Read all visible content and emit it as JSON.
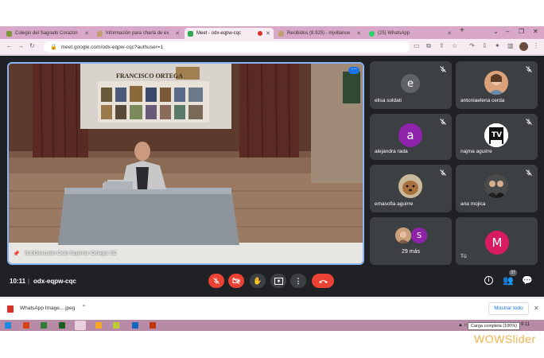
{
  "tabs": [
    {
      "label": "Colegio del Sagrado Corazón",
      "favicon_color": "#7a9a3a"
    },
    {
      "label": "Información para charla de ex",
      "favicon_color": "#c0a070"
    },
    {
      "label": "Meet - odx-eqpw-cqc",
      "favicon_color": "#34a853",
      "active": true
    },
    {
      "label": "Recibidos (8.925) - mjvillanue",
      "favicon_color": "#c0a070"
    },
    {
      "label": "(25) WhatsApp",
      "favicon_color": "#25d366"
    }
  ],
  "browser": {
    "url": "meet.google.com/odx-eqpw-cqc?authuser=1"
  },
  "meet": {
    "presenter_label": "SubDirección Ciclo Superior Colegio SC",
    "stage_banner": "FRANCISCO ORTEGA",
    "time": "10:11",
    "meeting_code": "odx-eqpw-cqc",
    "people_count": "37",
    "participants": [
      {
        "name": "elisa soldati",
        "initial": "e",
        "avatar_color": "#5f6368",
        "kind": "letter"
      },
      {
        "name": "antoniaelena cerda",
        "initial": "",
        "avatar_color": "#c47a45",
        "kind": "photo"
      },
      {
        "name": "alejandra rada",
        "initial": "a",
        "avatar_color": "#8e24aa",
        "kind": "letter"
      },
      {
        "name": "najma aguirre",
        "initial": "",
        "avatar_color": "#ffffff",
        "kind": "photo-tv"
      },
      {
        "name": "emasofia aguirre",
        "initial": "",
        "avatar_color": "#b08050",
        "kind": "photo"
      },
      {
        "name": "ana mojica",
        "initial": "",
        "avatar_color": "#3a3a3a",
        "kind": "photo"
      },
      {
        "name": "29 más",
        "initial": "S",
        "avatar_color": "#8e24aa",
        "kind": "more"
      },
      {
        "name": "Tú",
        "initial": "M",
        "avatar_color": "#d81b60",
        "kind": "letter-large"
      }
    ]
  },
  "downloads": {
    "file": "WhatsApp Image....jpeg",
    "show_all": "Mostrar todo"
  },
  "taskbar": {
    "tooltip": "Carga completa (100%)",
    "clock": "9:11"
  },
  "watermark": "WOWSlider"
}
